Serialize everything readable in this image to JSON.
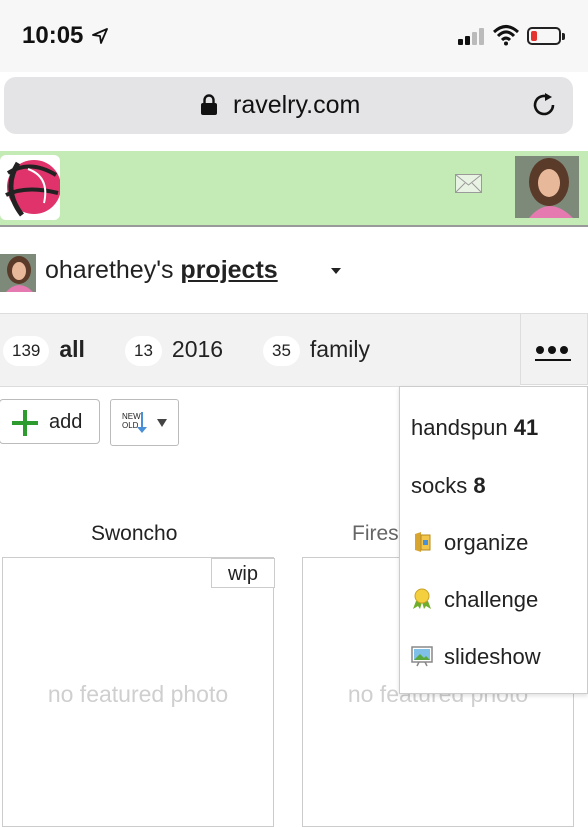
{
  "status_bar": {
    "time": "10:05"
  },
  "browser": {
    "url": "ravelry.com"
  },
  "header": {
    "brand_color": "#c4ebb6"
  },
  "page": {
    "owner": "oharethey's",
    "title": "projects"
  },
  "tabs": [
    {
      "count": "139",
      "label": "all",
      "active": true
    },
    {
      "count": "13",
      "label": "2016",
      "active": false
    },
    {
      "count": "35",
      "label": "family",
      "active": false
    }
  ],
  "toolbar": {
    "add_label": "add",
    "sort_new": "NEW",
    "sort_old": "OLD"
  },
  "projects": [
    {
      "name": "Swoncho",
      "status": "wip",
      "photo": "no featured photo"
    },
    {
      "name": "Fires",
      "status": "",
      "photo": "no featured photo"
    }
  ],
  "more_menu": {
    "items": [
      {
        "label": "handspun",
        "count": "41",
        "icon": ""
      },
      {
        "label": "socks",
        "count": "8",
        "icon": ""
      },
      {
        "label": "organize",
        "count": "",
        "icon": "folder-icon"
      },
      {
        "label": "challenge",
        "count": "",
        "icon": "ribbon-icon"
      },
      {
        "label": "slideshow",
        "count": "",
        "icon": "slideshow-icon"
      }
    ]
  }
}
